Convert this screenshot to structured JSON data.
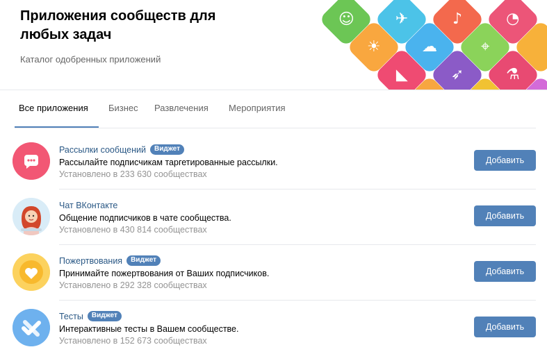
{
  "header": {
    "title": "Приложения сообществ для любых задач",
    "subtitle": "Каталог одобренных приложений"
  },
  "hero_tiles": [
    {
      "icon": "smile-icon",
      "color": "#6cc655"
    },
    {
      "icon": "plane-icon",
      "color": "#4cc3e8"
    },
    {
      "icon": "bell-icon",
      "color": "#f3694d"
    },
    {
      "icon": "chart-icon",
      "color": "#ec5578"
    },
    {
      "icon": "sun-icon",
      "color": "#f9a73f"
    },
    {
      "icon": "cloud-icon",
      "color": "#4ab3ee"
    },
    {
      "icon": "map-pin-icon",
      "color": "#8bd35a"
    },
    {
      "icon": "boot-icon",
      "color": "#ef4b72"
    },
    {
      "icon": "rocket-icon",
      "color": "#8b5bc7"
    },
    {
      "icon": "flask-icon",
      "color": "#e84a72"
    }
  ],
  "tabs": [
    {
      "label": "Все приложения"
    },
    {
      "label": "Бизнес"
    },
    {
      "label": "Развлечения"
    },
    {
      "label": "Мероприятия"
    }
  ],
  "apps": [
    {
      "name": "Рассылки сообщений",
      "badge": "Виджет",
      "description": "Рассылайте подписчикам таргетированные рассылки.",
      "installs": "Установлено в 233 630 сообществах",
      "button": "Добавить",
      "icon": "message-dots-icon",
      "color": "#f25774"
    },
    {
      "name": "Чат ВКонтакте",
      "badge": "",
      "description": "Общение подписчиков в чате сообщества.",
      "installs": "Установлено в 430 814 сообществах",
      "button": "Добавить",
      "icon": "girl-avatar-icon",
      "color": "#d9ecf7"
    },
    {
      "name": "Пожертвования",
      "badge": "Виджет",
      "description": "Принимайте пожертвования от Ваших подписчиков.",
      "installs": "Установлено в 292 328 сообществах",
      "button": "Добавить",
      "icon": "heart-icon",
      "color": "#fcd25e"
    },
    {
      "name": "Тесты",
      "badge": "Виджет",
      "description": "Интерактивные тесты в Вашем сообществе.",
      "installs": "Установлено в 152 673 сообществах",
      "button": "Добавить",
      "icon": "check-cross-icon",
      "color": "#6eb1ee"
    }
  ]
}
